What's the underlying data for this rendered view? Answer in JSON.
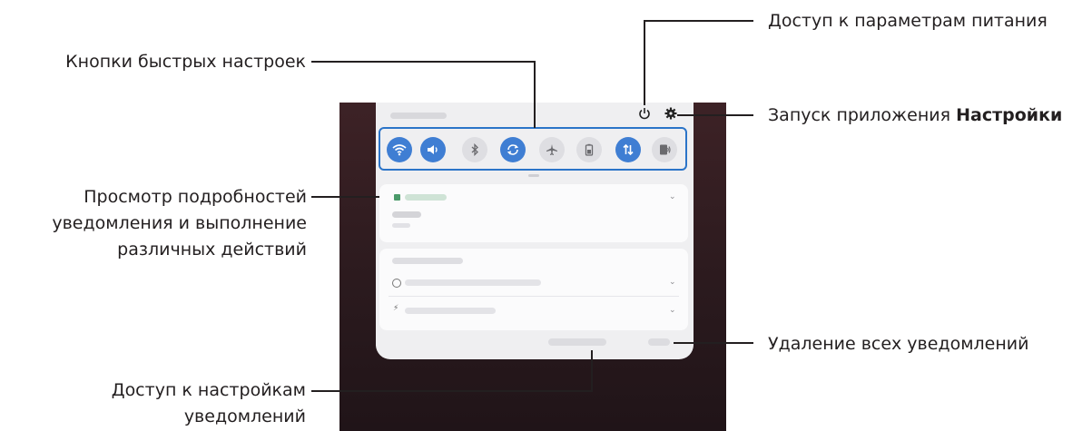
{
  "callouts": {
    "quick_settings": "Кнопки быстрых настроек",
    "notification_details_1": "Просмотр подробностей",
    "notification_details_2": "уведомления и выполнение",
    "notification_details_3": "различных действий",
    "notification_settings_1": "Доступ к настройкам",
    "notification_settings_2": "уведомлений",
    "power_options": "Доступ к параметрам питания",
    "launch_settings_prefix": "Запуск приложения",
    "launch_settings_bold": "Настройки",
    "clear_all": "Удаление всех уведомлений"
  },
  "icons": {
    "power": "power-icon",
    "settings": "gear-icon",
    "quick_settings": [
      {
        "name": "wifi-icon",
        "active": true
      },
      {
        "name": "sound-icon",
        "active": true
      },
      {
        "name": "bluetooth-icon",
        "active": false
      },
      {
        "name": "auto-rotate-icon",
        "active": true
      },
      {
        "name": "airplane-mode-icon",
        "active": false
      },
      {
        "name": "power-saving-icon",
        "active": false
      },
      {
        "name": "mobile-data-icon",
        "active": true
      },
      {
        "name": "nfc-icon",
        "active": false
      }
    ]
  },
  "colors": {
    "accent": "#3f7ed3",
    "callout_frame": "#2b74c8",
    "backdrop": "#2b1a1e"
  }
}
